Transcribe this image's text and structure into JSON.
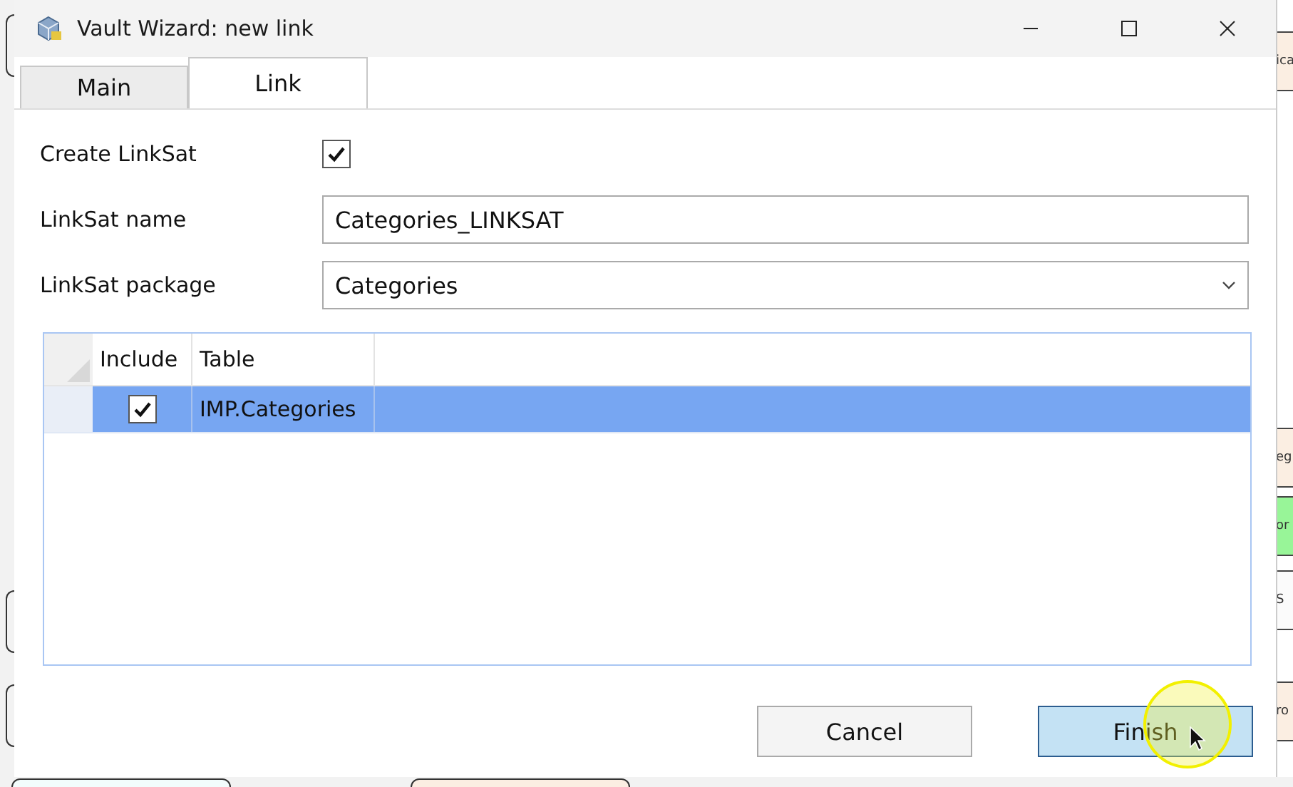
{
  "window": {
    "title": "Vault Wizard: new link"
  },
  "tabs": [
    {
      "label": "Main",
      "selected": false
    },
    {
      "label": "Link",
      "selected": true
    }
  ],
  "create_linksat": {
    "label": "Create LinkSat",
    "checked": true
  },
  "linksat_name": {
    "label": "LinkSat name",
    "value": "Categories_LINKSAT"
  },
  "linksat_package": {
    "label": "LinkSat package",
    "value": "Categories"
  },
  "table": {
    "columns": [
      "Include",
      "Table"
    ],
    "rows": [
      {
        "include": true,
        "table": "IMP.Categories",
        "selected": true
      }
    ]
  },
  "buttons": [
    {
      "label": "Cancel",
      "kind": "normal"
    },
    {
      "label": "Finish",
      "kind": "default"
    }
  ],
  "background_labels": [
    {
      "text": "ica",
      "color": "#fbeee2"
    },
    {
      "text": "eg",
      "color": "#fbeee2"
    },
    {
      "text": "or",
      "color": "#98f598"
    },
    {
      "text": "S",
      "color": "#fbfbfb"
    },
    {
      "text": "ro",
      "color": "#fbeee2"
    }
  ]
}
